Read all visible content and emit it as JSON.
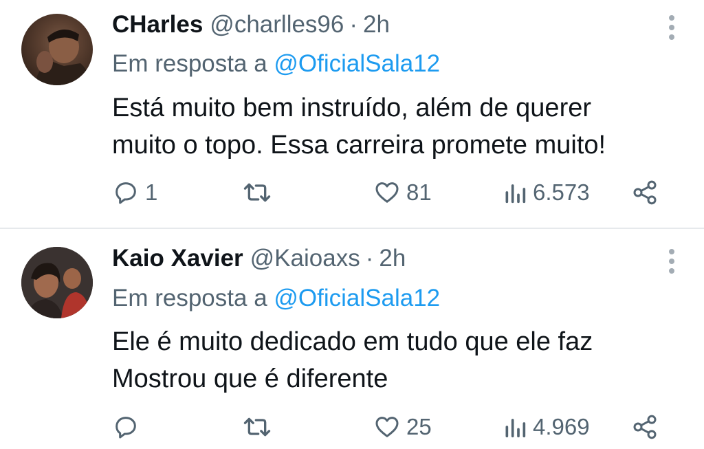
{
  "tweets": [
    {
      "display_name": "CHarles",
      "handle": "@charlles96",
      "separator": "·",
      "time": "2h",
      "reply_prefix": "Em resposta a",
      "reply_mention": "@OficialSala12",
      "text_lines": [
        "Está muito bem instruído, além de querer",
        "muito o topo. Essa carreira promete muito!"
      ],
      "replies": "1",
      "retweets": "",
      "likes": "81",
      "views": "6.573"
    },
    {
      "display_name": "Kaio Xavier",
      "handle": "@Kaioaxs",
      "separator": "·",
      "time": "2h",
      "reply_prefix": "Em resposta a",
      "reply_mention": "@OficialSala12",
      "text_lines": [
        "Ele é muito dedicado em tudo que ele faz",
        "Mostrou que é diferente"
      ],
      "replies": "",
      "retweets": "",
      "likes": "25",
      "views": "4.969"
    }
  ],
  "icons": {
    "reply": "reply-icon",
    "retweet": "retweet-icon",
    "like": "heart-icon",
    "views": "views-icon",
    "share": "share-icon",
    "more": "more-vertical-icon"
  },
  "colors": {
    "text_primary": "#0f1419",
    "text_secondary": "#536471",
    "link": "#1d9bf0",
    "divider": "#e6e9ec"
  }
}
